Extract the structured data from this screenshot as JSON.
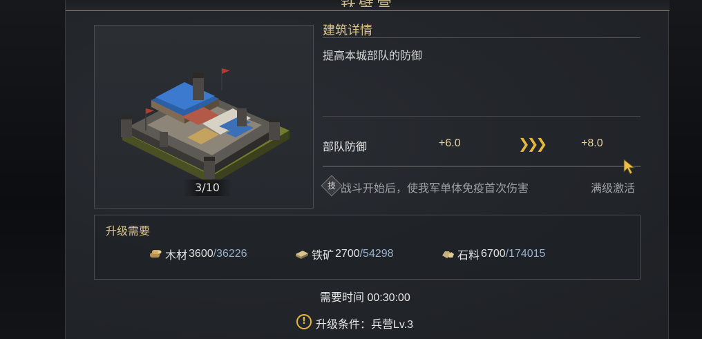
{
  "header": {
    "title_fragment": "铁壁营"
  },
  "building": {
    "level": "3/10",
    "section_title": "建筑详情",
    "description": "提高本城部队的防御"
  },
  "stat": {
    "name": "部队防御",
    "current": "+6.0",
    "arrows_icon": "triple-chevron-right-icon",
    "next": "+8.0"
  },
  "skill": {
    "icon_glyph": "技",
    "text": "战斗开始后，使我军单体免疫首次伤害",
    "status": "满级激活"
  },
  "requirements": {
    "title": "升级需要",
    "resources": [
      {
        "icon": "wood-icon",
        "name": "木材",
        "need": "3600",
        "have": "/36226"
      },
      {
        "icon": "iron-ore-icon",
        "name": "铁矿",
        "need": "2700",
        "have": "/54298"
      },
      {
        "icon": "stone-icon",
        "name": "石料",
        "need": "6700",
        "have": "/174015"
      }
    ]
  },
  "time": {
    "text": "需要时间 00:30:00"
  },
  "condition": {
    "icon_glyph": "!",
    "text": "升级条件：兵营Lv.3"
  },
  "colors": {
    "accent_gold": "#d9c48d",
    "arrow_gold": "#e6b93a",
    "have_blue": "#9ab0cc"
  }
}
